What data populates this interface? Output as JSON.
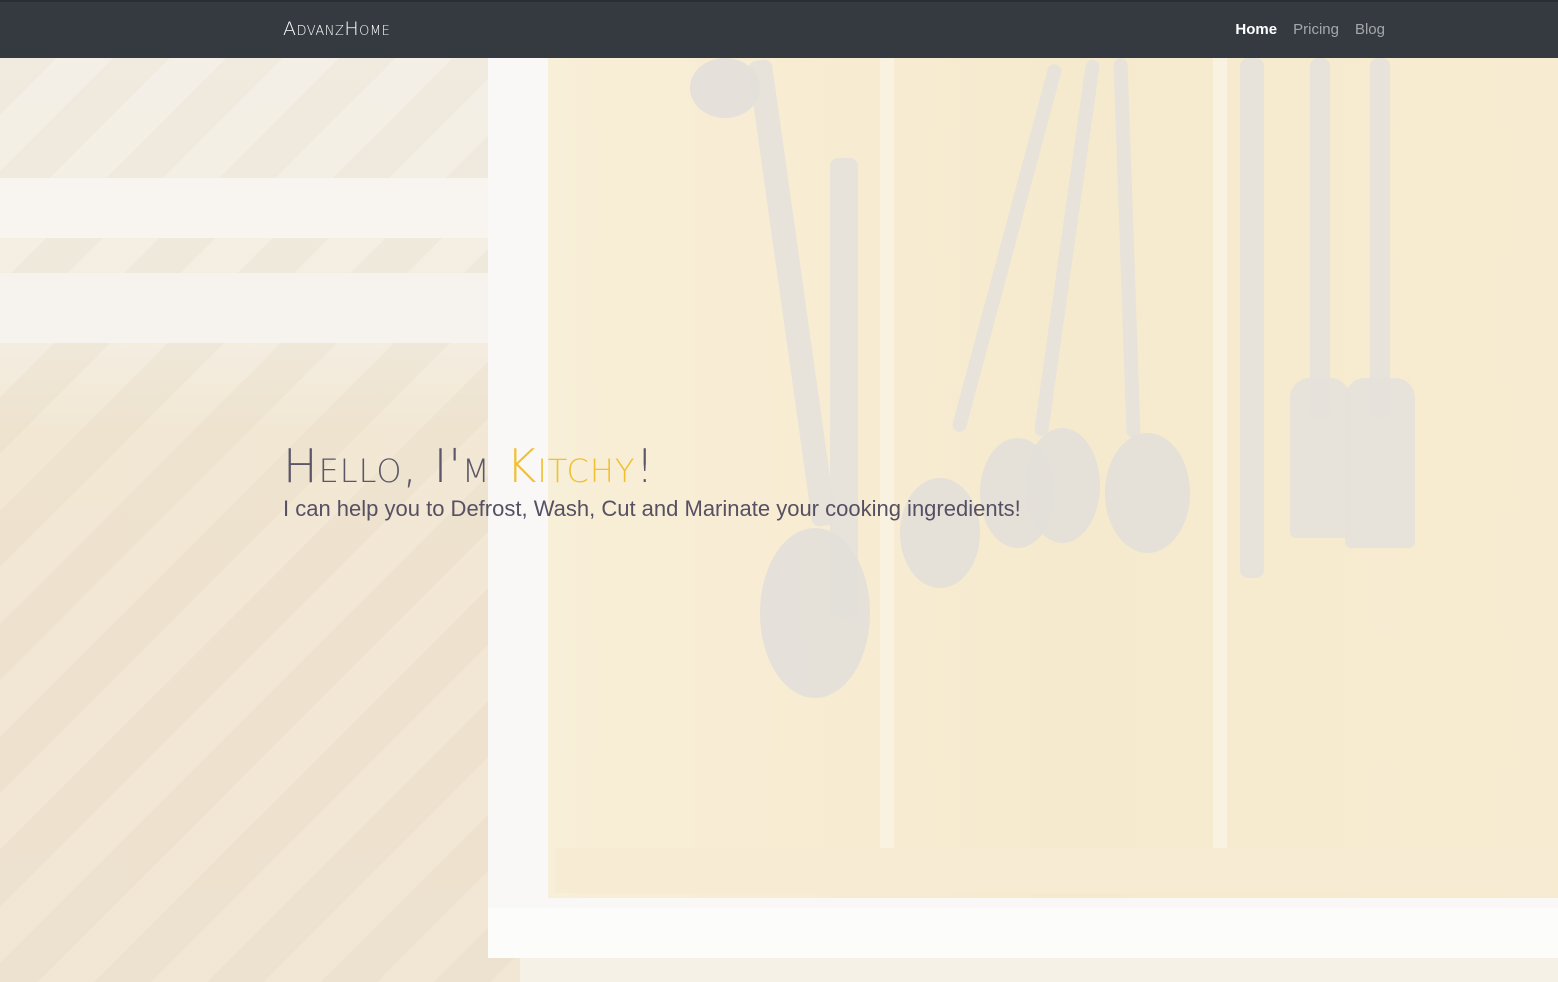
{
  "navbar": {
    "brand": "AdvanzHome",
    "links": [
      {
        "label": "Home",
        "active": true
      },
      {
        "label": "Pricing",
        "active": false
      },
      {
        "label": "Blog",
        "active": false
      }
    ]
  },
  "hero": {
    "title_prefix": "Hello, I'm ",
    "title_accent": "Kitchy",
    "title_suffix": "!",
    "subtitle": "I can help you to Defrost, Wash, Cut and Marinate your cooking ingredients!",
    "background_image": "cutlery-drawer-photo"
  },
  "colors": {
    "navbar_bg": "#343a40",
    "accent": "#f0c030",
    "hero_text": "#5c5768"
  }
}
